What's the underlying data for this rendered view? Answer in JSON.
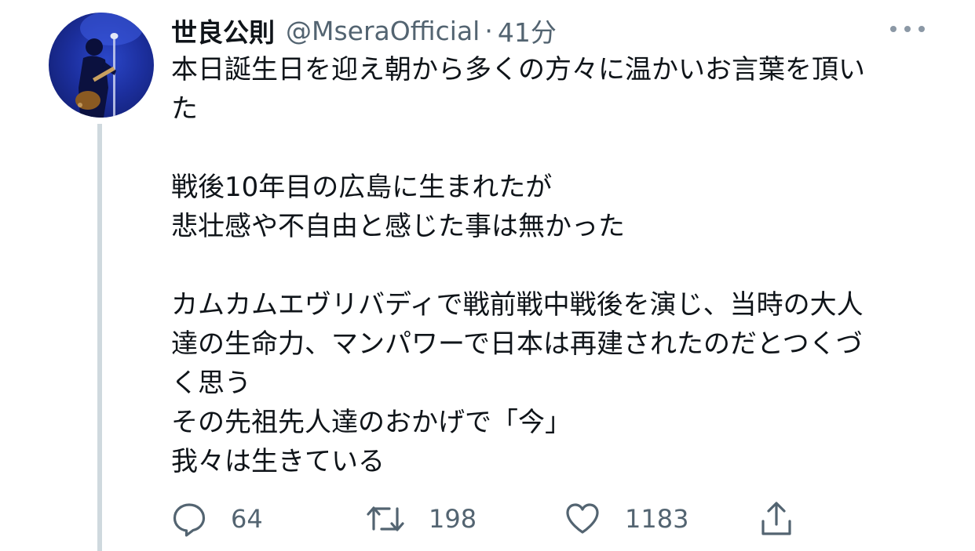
{
  "tweet": {
    "display_name": "世良公則",
    "handle": "@MseraOfficial",
    "separator": "·",
    "time": "41分",
    "avatar_alt": "avatar",
    "paragraphs": [
      [
        "本日誕生日を迎え朝から多くの方々に温かいお言葉を頂い",
        "た"
      ],
      [
        "戦後10年目の広島に生まれたが",
        "悲壮感や不自由と感じた事は無かった"
      ],
      [
        "カムカムエヴリバディで戦前戦中戦後を演じ、当時の大人",
        "達の生命力、マンパワーで日本は再建されたのだとつくづ",
        "く思う",
        "その先祖先人達のおかげで「今」",
        "我々は生きている"
      ]
    ],
    "actions": {
      "reply_count": "64",
      "retweet_count": "198",
      "like_count": "1183"
    },
    "icons": {
      "reply": "reply-icon",
      "retweet": "retweet-icon",
      "like": "heart-icon",
      "share": "share-icon",
      "more": "more-icon"
    },
    "colors": {
      "text": "#0f1419",
      "secondary": "#536471",
      "thread_line": "#cfd9de",
      "avatar_bg": "#1c2f9e"
    }
  }
}
